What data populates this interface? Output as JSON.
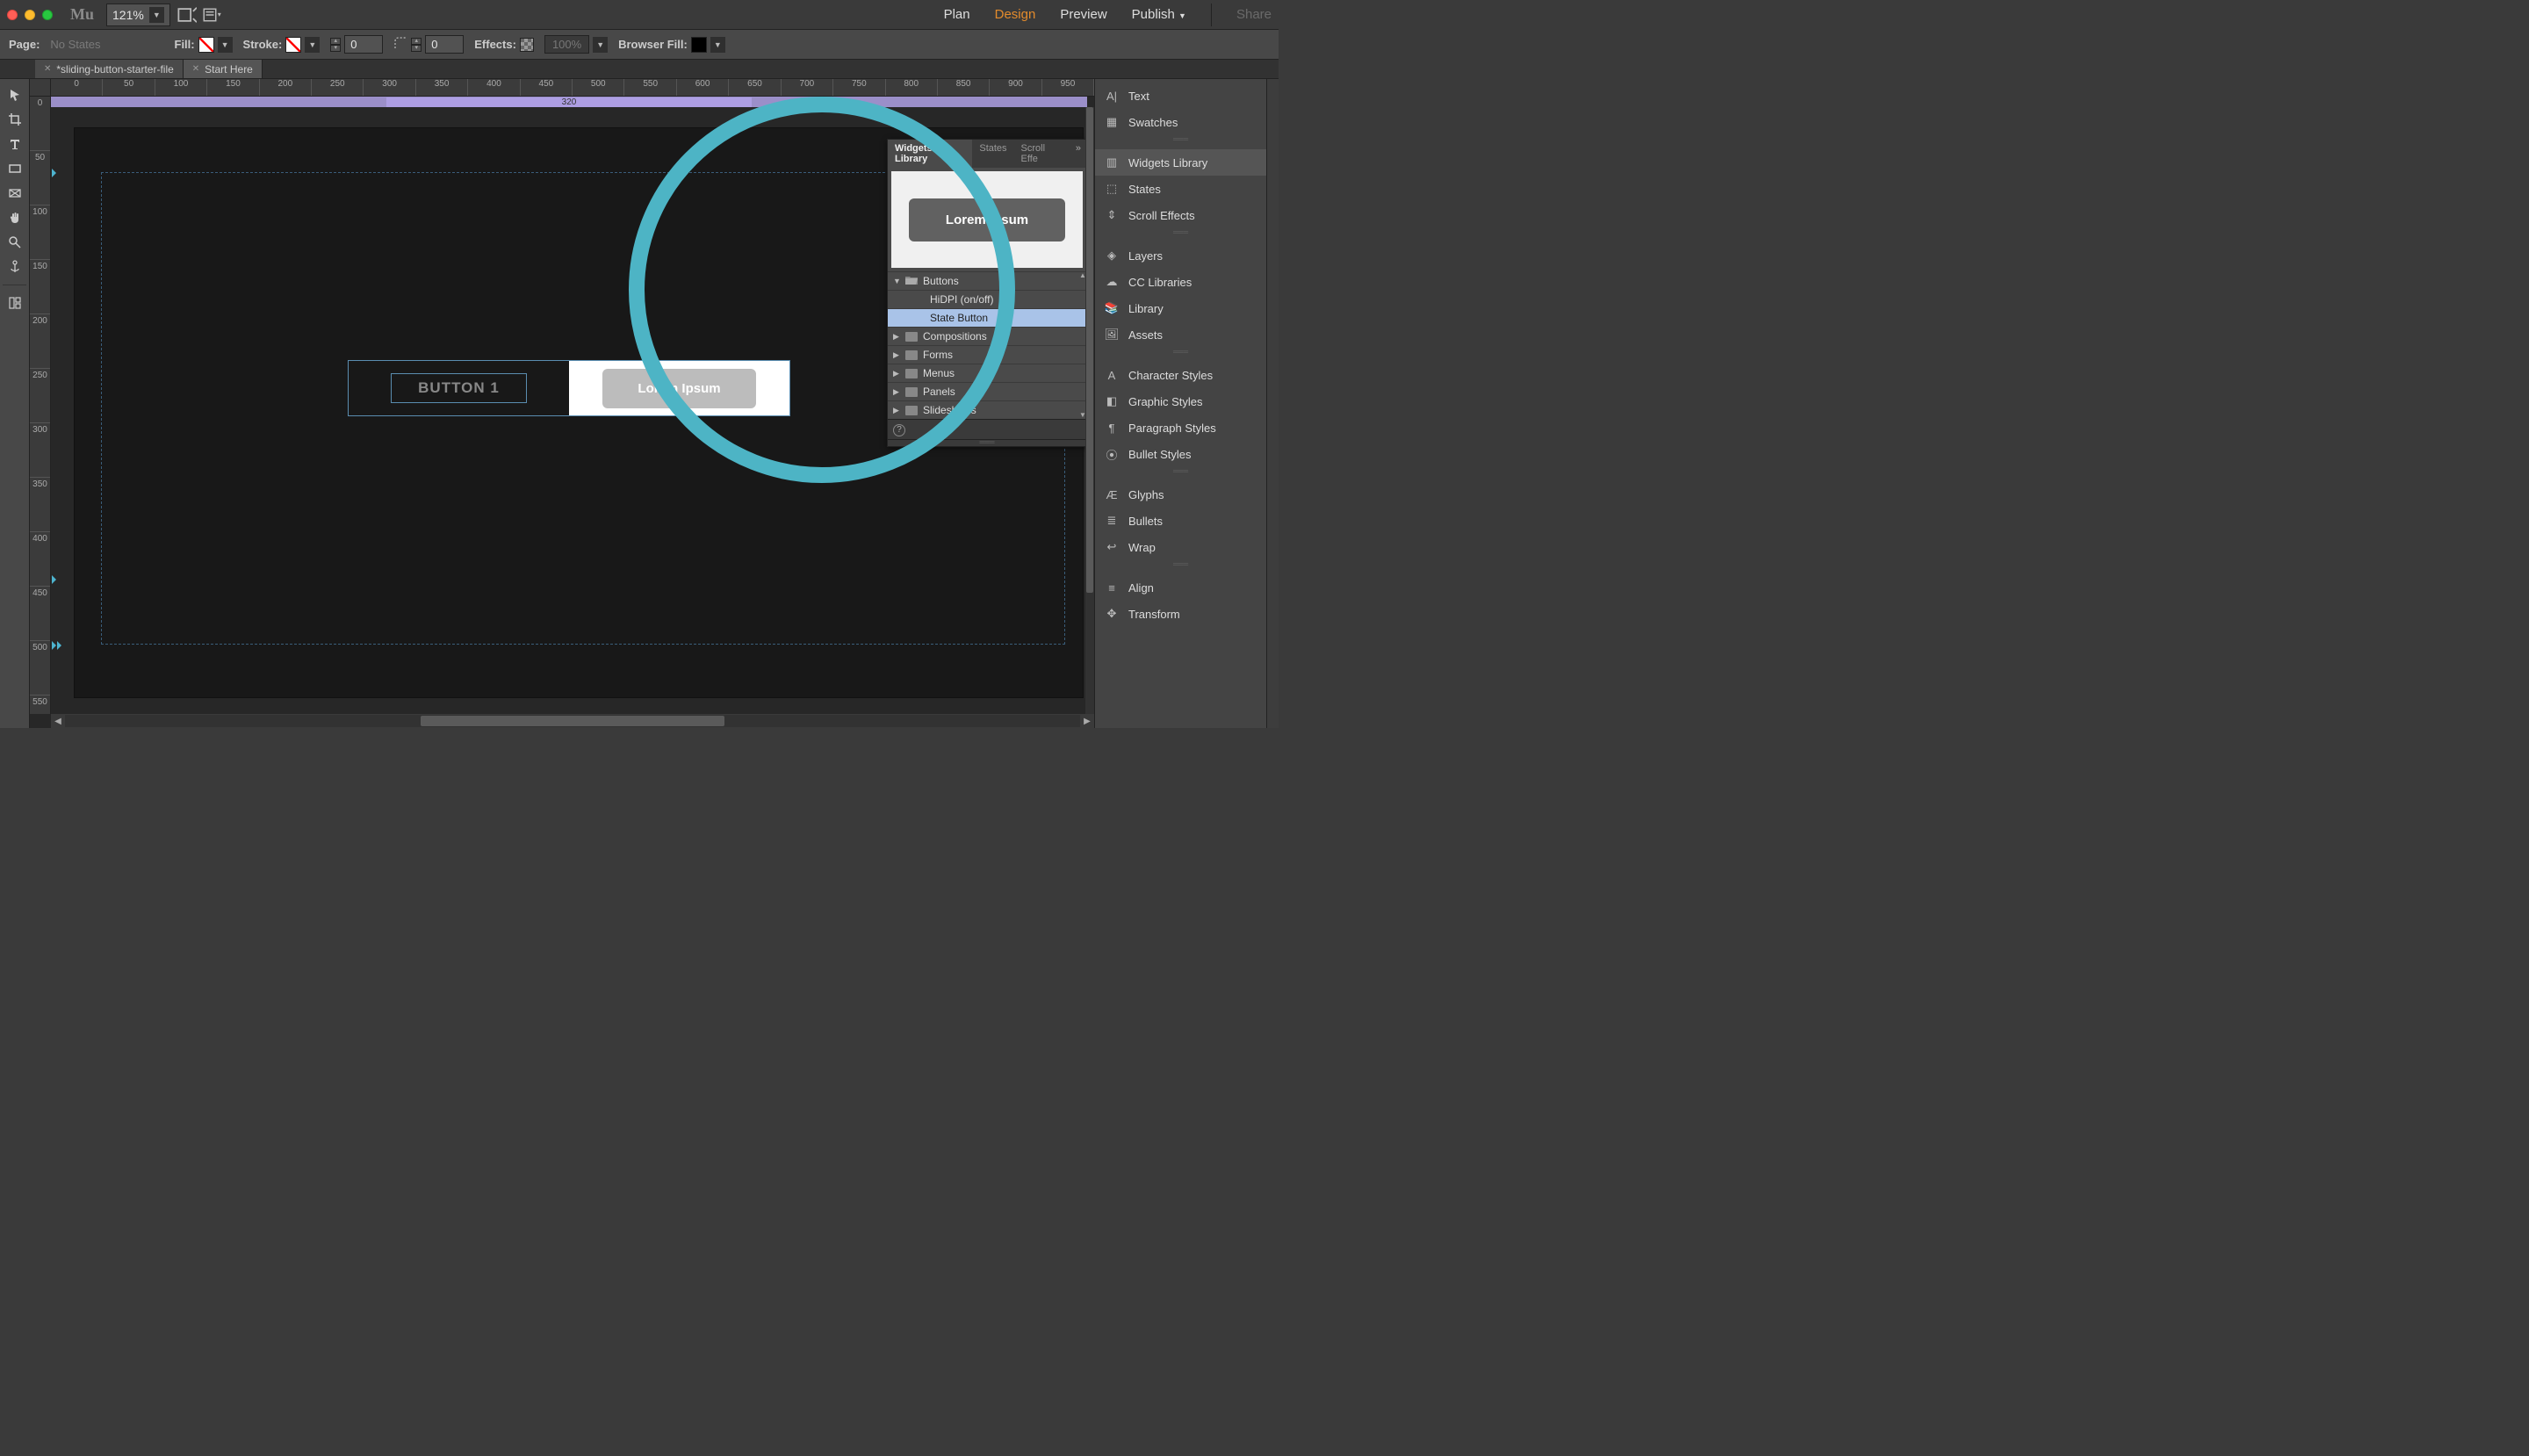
{
  "titlebar": {
    "logo": "Mu",
    "zoom": "121%",
    "nav": {
      "plan": "Plan",
      "design": "Design",
      "preview": "Preview",
      "publish": "Publish",
      "share": "Share"
    }
  },
  "controlbar": {
    "page_label": "Page:",
    "page_state": "No States",
    "fill_label": "Fill:",
    "stroke_label": "Stroke:",
    "stroke_value": "0",
    "corner_value": "0",
    "effects_label": "Effects:",
    "opacity": "100%",
    "browser_fill_label": "Browser Fill:"
  },
  "tabs": [
    {
      "label": "*sliding-button-starter-file",
      "active": false
    },
    {
      "label": "Start Here",
      "active": true
    }
  ],
  "ruler_h": [
    "0",
    "50",
    "100",
    "150",
    "200",
    "250",
    "300",
    "350",
    "400",
    "450",
    "500",
    "550",
    "600",
    "650",
    "700",
    "750",
    "800",
    "850",
    "900",
    "950"
  ],
  "ruler_v": [
    "0",
    "50",
    "100",
    "150",
    "200",
    "250",
    "300",
    "350",
    "400",
    "450",
    "500",
    "550"
  ],
  "header_band": "320",
  "canvas": {
    "button1": "BUTTON 1",
    "lorem": "Lorem Ipsum"
  },
  "widgets_panel": {
    "tabs": {
      "library": "Widgets Library",
      "states": "States",
      "scroll": "Scroll Effe"
    },
    "preview_label": "Lorem Ipsum",
    "tree": {
      "buttons": "Buttons",
      "hidpi": "HiDPI (on/off)",
      "state_button": "State Button",
      "compositions": "Compositions",
      "forms": "Forms",
      "menus": "Menus",
      "panels": "Panels",
      "slideshows": "Slideshows"
    },
    "help": "?"
  },
  "rightdock": [
    "Text",
    "Swatches",
    "",
    "Widgets Library",
    "States",
    "Scroll Effects",
    "",
    "Layers",
    "CC Libraries",
    "Library",
    "Assets",
    "",
    "Character Styles",
    "Graphic Styles",
    "Paragraph Styles",
    "Bullet Styles",
    "",
    "Glyphs",
    "Bullets",
    "Wrap",
    "",
    "Align",
    "Transform"
  ],
  "rightdock_active_index": 3,
  "icons": {
    "text": "A|",
    "swatches": "▦",
    "widgets": "▥",
    "states": "⬚",
    "scroll": "⇕",
    "layers": "◈",
    "cc": "☁",
    "library": "📚",
    "assets": "🖼",
    "char": "A",
    "graph": "◧",
    "para": "¶",
    "bullets": "⦿",
    "glyphs": "Æ",
    "bull2": "≣",
    "wrap": "↩",
    "align": "≡",
    "trans": "✥"
  }
}
